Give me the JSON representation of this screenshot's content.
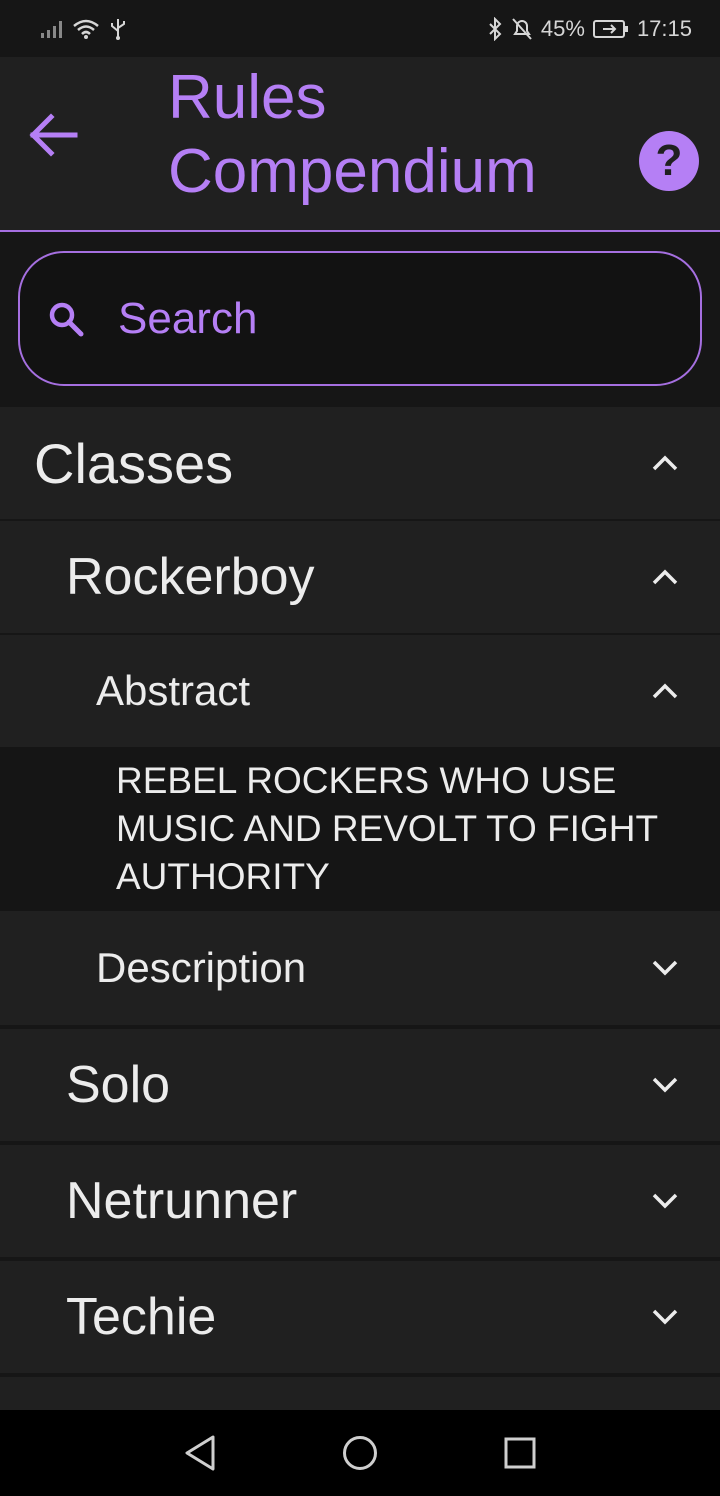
{
  "status_bar": {
    "battery": "45%",
    "time": "17:15"
  },
  "app_bar": {
    "title": "Rules Compendium",
    "help_label": "?"
  },
  "search": {
    "placeholder": "Search"
  },
  "list": {
    "classes": {
      "label": "Classes",
      "expanded": true
    },
    "rockerboy": {
      "label": "Rockerboy",
      "expanded": true
    },
    "abstract": {
      "label": "Abstract",
      "expanded": true,
      "text": "REBEL ROCKERS WHO USE MUSIC AND REVOLT TO FIGHT AUTHORITY"
    },
    "description": {
      "label": "Description",
      "expanded": false
    },
    "solo": {
      "label": "Solo",
      "expanded": false
    },
    "netrunner": {
      "label": "Netrunner",
      "expanded": false
    },
    "techie": {
      "label": "Techie",
      "expanded": false
    }
  },
  "colors": {
    "accent": "#b57ff5",
    "background": "#161616",
    "row": "#202020",
    "text": "#ececec"
  },
  "icons": {
    "back": "arrow-left-icon",
    "help": "help-circle-icon",
    "search": "search-icon",
    "expanded": "chevron-up-icon",
    "collapsed": "chevron-down-icon"
  }
}
